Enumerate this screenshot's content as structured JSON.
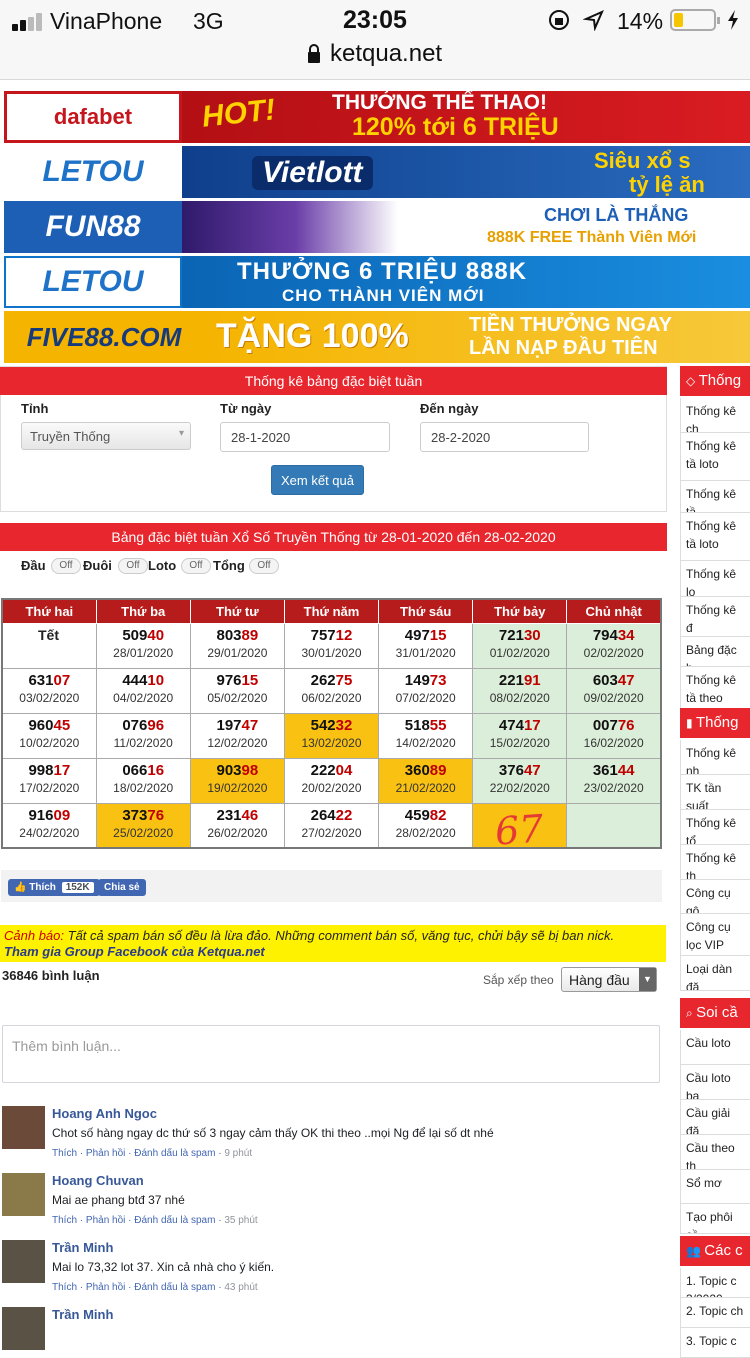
{
  "status_bar": {
    "carrier": "VinaPhone",
    "network": "3G",
    "time": "23:05",
    "battery": "14%",
    "url": "ketqua.net"
  },
  "banners": [
    {
      "brand": "dafabet",
      "hot": "HOT!",
      "line1": "THƯỞNG THỂ THAO!",
      "line2": "120% tới 6 TRIỆU"
    },
    {
      "brand": "LETOU",
      "center": "Vietlott",
      "line1": "Siêu xổ s",
      "line2": "tỷ lệ ăn"
    },
    {
      "brand": "FUN88",
      "line1": "CHƠI LÀ THẮNG",
      "line2": "888K FREE Thành Viên Mới"
    },
    {
      "brand": "LETOU",
      "line1": "THƯỞNG 6 TRIỆU 888K",
      "line2": "CHO THÀNH VIÊN MỚI"
    },
    {
      "brand": "FIVE88.COM",
      "line1": "TẶNG 100%",
      "line2": "TIỀN THƯỞNG NGAY",
      "line3": "LẦN NẠP ĐẦU TIÊN"
    }
  ],
  "form": {
    "title": "Thống kê bảng đặc biệt tuần",
    "province_label": "Tỉnh",
    "province_value": "Truyền Thống",
    "from_label": "Từ ngày",
    "from_value": "28-1-2020",
    "to_label": "Đến ngày",
    "to_value": "28-2-2020",
    "submit": "Xem kết quả"
  },
  "result": {
    "title": "Bảng đặc biệt tuần Xổ Số Truyền Thống từ 28-01-2020 đến 28-02-2020",
    "toggles": [
      {
        "label": "Đầu",
        "state": "Off"
      },
      {
        "label": "Đuôi",
        "state": "Off"
      },
      {
        "label": "Loto",
        "state": "Off"
      },
      {
        "label": "Tổng",
        "state": "Off"
      }
    ],
    "headers": [
      "Thứ hai",
      "Thứ ba",
      "Thứ tư",
      "Thứ năm",
      "Thứ sáu",
      "Thứ bảy",
      "Chủ nhật"
    ],
    "tet_label": "Tết",
    "handwritten": "67"
  },
  "rows": [
    [
      {
        "tet": true
      },
      {
        "pre": "509",
        "tail": "40",
        "date": "28/01/2020"
      },
      {
        "pre": "803",
        "tail": "89",
        "date": "29/01/2020"
      },
      {
        "pre": "757",
        "tail": "12",
        "date": "30/01/2020"
      },
      {
        "pre": "497",
        "tail": "15",
        "date": "31/01/2020"
      },
      {
        "pre": "721",
        "tail": "30",
        "date": "01/02/2020"
      },
      {
        "pre": "794",
        "tail": "34",
        "date": "02/02/2020"
      }
    ],
    [
      {
        "pre": "631",
        "tail": "07",
        "date": "03/02/2020"
      },
      {
        "pre": "444",
        "tail": "10",
        "date": "04/02/2020"
      },
      {
        "pre": "976",
        "tail": "15",
        "date": "05/02/2020"
      },
      {
        "pre": "262",
        "tail": "75",
        "date": "06/02/2020"
      },
      {
        "pre": "149",
        "tail": "73",
        "date": "07/02/2020"
      },
      {
        "pre": "221",
        "tail": "91",
        "date": "08/02/2020"
      },
      {
        "pre": "603",
        "tail": "47",
        "date": "09/02/2020"
      }
    ],
    [
      {
        "pre": "960",
        "tail": "45",
        "date": "10/02/2020"
      },
      {
        "pre": "076",
        "tail": "96",
        "date": "11/02/2020"
      },
      {
        "pre": "197",
        "tail": "47",
        "date": "12/02/2020"
      },
      {
        "pre": "542",
        "tail": "32",
        "date": "13/02/2020",
        "hl": true
      },
      {
        "pre": "518",
        "tail": "55",
        "date": "14/02/2020"
      },
      {
        "pre": "474",
        "tail": "17",
        "date": "15/02/2020"
      },
      {
        "pre": "007",
        "tail": "76",
        "date": "16/02/2020"
      }
    ],
    [
      {
        "pre": "998",
        "tail": "17",
        "date": "17/02/2020"
      },
      {
        "pre": "066",
        "tail": "16",
        "date": "18/02/2020"
      },
      {
        "pre": "903",
        "tail": "98",
        "date": "19/02/2020",
        "hl": true
      },
      {
        "pre": "222",
        "tail": "04",
        "date": "20/02/2020"
      },
      {
        "pre": "360",
        "tail": "89",
        "date": "21/02/2020",
        "hl": true
      },
      {
        "pre": "376",
        "tail": "47",
        "date": "22/02/2020"
      },
      {
        "pre": "361",
        "tail": "44",
        "date": "23/02/2020"
      }
    ],
    [
      {
        "pre": "916",
        "tail": "09",
        "date": "24/02/2020"
      },
      {
        "pre": "373",
        "tail": "76",
        "date": "25/02/2020",
        "hl": true
      },
      {
        "pre": "231",
        "tail": "46",
        "date": "26/02/2020"
      },
      {
        "pre": "264",
        "tail": "22",
        "date": "27/02/2020"
      },
      {
        "pre": "459",
        "tail": "82",
        "date": "28/02/2020"
      },
      {
        "empty": true,
        "hl": true
      },
      {
        "empty": true
      }
    ]
  ],
  "social": {
    "like": "Thích",
    "like_count": "152K",
    "share": "Chia sẻ"
  },
  "comments_section": {
    "warning_prefix": "Cảnh báo:",
    "warning": "Tất cả spam bán số đều là lừa đảo. Những comment bán số, văng tục, chửi bậy sẽ bị ban nick.",
    "group_link": "Tham gia Group Facebook của Ketqua.net",
    "count": "36846 bình luận",
    "sort_label": "Sắp xếp theo",
    "sort_value": "Hàng đầu",
    "placeholder": "Thêm bình luận...",
    "items": [
      {
        "name": "Hoang Anh Ngoc",
        "text": "Chot số hàng ngay dc thứ số 3 ngay cảm thấy OK thi theo ..mọi Ng để lại số dt nhé",
        "actions": "Thích · Phản hồi · Đánh dấu là spam · ",
        "ago": "9 phút"
      },
      {
        "name": "Hoang Chuvan",
        "text": "Mai ae phang btđ 37 nhé",
        "actions": "Thích · Phản hồi · Đánh dấu là spam · ",
        "ago": "35 phút"
      },
      {
        "name": "Trần Minh",
        "text": "Mai lo 73,32 lot 37. Xin cả nhà cho ý kiến.",
        "actions": "Thích · Phản hồi · Đánh dấu là spam · ",
        "ago": "43 phút"
      },
      {
        "name": "Trần Minh",
        "text": "",
        "actions": "",
        "ago": ""
      }
    ]
  },
  "sidebar": {
    "sections": [
      {
        "head": "Thống",
        "items": [
          "Thống kê ch",
          "Thống kê tầ loto",
          "Thống kê tầ",
          "Thống kê tầ loto",
          "Thống kê lo",
          "Thống kê đ",
          "Bảng đặc b",
          "Thống kê tầ theo Đặc Bi"
        ]
      },
      {
        "head": "Thống",
        "items": [
          "Thống kê nh",
          "TK tần suất",
          "Thống kê tổ",
          "Thống kê th",
          "Công cụ gộ",
          "Công cụ lọc VIP",
          "Loại dàn đặ"
        ]
      },
      {
        "head": "Soi cầ",
        "items": [
          "Cầu loto",
          "Cầu loto bạ",
          "Cầu giải đặ",
          "Cầu theo th",
          "Sổ mơ",
          "Tạo phôi cầ"
        ]
      },
      {
        "head": "Các c",
        "items": [
          "1. Topic c 3/2020",
          "2. Topic ch",
          "3. Topic c"
        ]
      }
    ]
  }
}
